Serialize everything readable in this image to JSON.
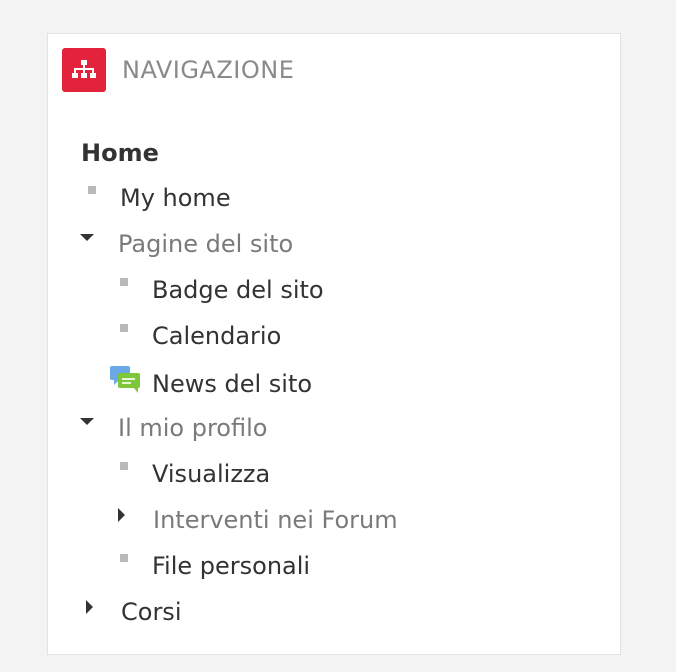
{
  "block": {
    "title": "NAVIGAZIONE",
    "icon": "sitemap-icon",
    "icon_color": "#e2233b"
  },
  "nav": {
    "home": "Home",
    "my_home": "My home",
    "site_pages": "Pagine del sito",
    "site_badges": "Badge del sito",
    "calendar": "Calendario",
    "site_news": "News del sito",
    "my_profile": "Il mio profilo",
    "view": "Visualizza",
    "forum_posts": "Interventi nei Forum",
    "private_files": "File personali",
    "courses": "Corsi"
  }
}
